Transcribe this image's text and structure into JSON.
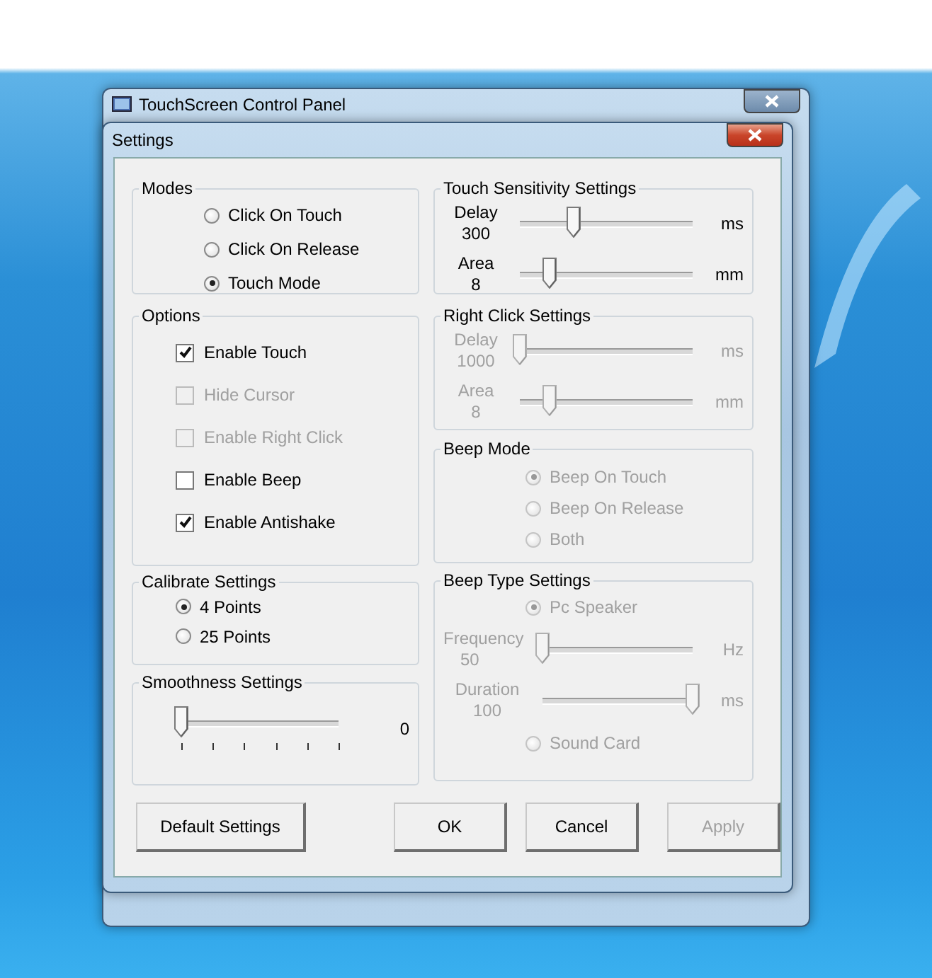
{
  "back_window": {
    "title": "TouchScreen Control Panel"
  },
  "dialog": {
    "title": "Settings"
  },
  "modes": {
    "title": "Modes",
    "options": [
      {
        "label": "Click On Touch",
        "selected": false
      },
      {
        "label": "Click On Release",
        "selected": false
      },
      {
        "label": "Touch Mode",
        "selected": true
      }
    ]
  },
  "touch_sensitivity": {
    "title": "Touch Sensitivity Settings",
    "disabled": false,
    "sliders": [
      {
        "label": "Delay",
        "value": "300",
        "unit": "ms",
        "level": 0.31
      },
      {
        "label": "Area",
        "value": "8",
        "unit": "mm",
        "level": 0.17
      }
    ]
  },
  "options": {
    "title": "Options",
    "items": [
      {
        "label": "Enable Touch",
        "checked": true,
        "disabled": false
      },
      {
        "label": "Hide Cursor",
        "checked": false,
        "disabled": true
      },
      {
        "label": "Enable Right Click",
        "checked": false,
        "disabled": true
      },
      {
        "label": "Enable Beep",
        "checked": false,
        "disabled": false
      },
      {
        "label": "Enable Antishake",
        "checked": true,
        "disabled": false
      }
    ]
  },
  "right_click": {
    "title": "Right Click Settings",
    "disabled": true,
    "sliders": [
      {
        "label": "Delay",
        "value": "1000",
        "unit": "ms",
        "level": 0.0
      },
      {
        "label": "Area",
        "value": "8",
        "unit": "mm",
        "level": 0.17
      }
    ]
  },
  "beep_mode": {
    "title": "Beep Mode",
    "disabled": true,
    "options": [
      {
        "label": "Beep On Touch",
        "selected": true
      },
      {
        "label": "Beep On Release",
        "selected": false
      },
      {
        "label": "Both",
        "selected": false
      }
    ]
  },
  "calibrate": {
    "title": "Calibrate Settings",
    "options": [
      {
        "label": "4 Points",
        "selected": true
      },
      {
        "label": "25 Points",
        "selected": false
      }
    ]
  },
  "smoothness": {
    "title": "Smoothness Settings",
    "value": "0",
    "level": 0.0
  },
  "beep_type": {
    "title": "Beep Type Settings",
    "disabled": true,
    "items": [
      {
        "kind": "radio",
        "label": "Pc Speaker",
        "selected": true
      },
      {
        "kind": "slider",
        "label": "Frequency",
        "value": "50",
        "unit": "Hz",
        "level": 0.0
      },
      {
        "kind": "slider",
        "label": "Duration",
        "value": "100",
        "unit": "ms",
        "level": 1.0
      },
      {
        "kind": "radio",
        "label": "Sound Card",
        "selected": false
      }
    ]
  },
  "buttons": [
    {
      "label": "Default Settings",
      "disabled": false
    },
    {
      "label": "OK",
      "disabled": false
    },
    {
      "label": "Cancel",
      "disabled": false
    },
    {
      "label": "Apply",
      "disabled": true
    }
  ]
}
